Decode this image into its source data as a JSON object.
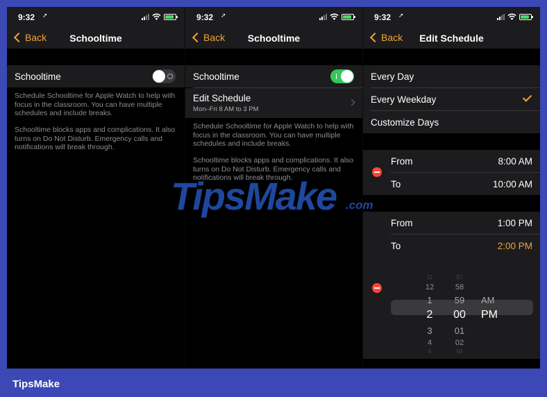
{
  "status": {
    "time": "9:32",
    "location_glyph": "➚"
  },
  "screens": [
    {
      "back_label": "Back",
      "title": "Schooltime",
      "toggle_label": "Schooltime",
      "toggle_on": false,
      "footnote1": "Schedule Schooltime for Apple Watch to help with focus in the classroom. You can have multiple schedules and include breaks.",
      "footnote2": "Schooltime blocks apps and complications. It also turns on Do Not Disturb. Emergency calls and notifications will break through."
    },
    {
      "back_label": "Back",
      "title": "Schooltime",
      "toggle_label": "Schooltime",
      "toggle_on": true,
      "edit_label": "Edit Schedule",
      "edit_sub": "Mon–Fri 8 AM to 3 PM",
      "footnote1": "Schedule Schooltime for Apple Watch to help with focus in the classroom. You can have multiple schedules and include breaks.",
      "footnote2": "Schooltime blocks apps and complications. It also turns on Do Not Disturb. Emergency calls and notifications will break through."
    },
    {
      "back_label": "Back",
      "title": "Edit Schedule",
      "options": [
        "Every Day",
        "Every Weekday",
        "Customize Days"
      ],
      "selected_option": "Every Weekday",
      "block1": {
        "from_label": "From",
        "from_value": "8:00 AM",
        "to_label": "To",
        "to_value": "10:00 AM"
      },
      "block2": {
        "from_label": "From",
        "from_value": "1:00 PM",
        "to_label": "To",
        "to_value": "2:00 PM"
      },
      "picker": {
        "hours": [
          "11",
          "12",
          "1",
          "2",
          "3",
          "4",
          "5"
        ],
        "minutes": [
          "57",
          "58",
          "59",
          "00",
          "01",
          "02",
          "03"
        ],
        "periods": [
          "AM",
          "PM"
        ]
      }
    }
  ],
  "watermark": {
    "text": "TipsMake",
    "suffix": ".com"
  },
  "brand": "TipsMake",
  "colors": {
    "accent": "#f3a33a",
    "toggle_on": "#34c759",
    "destructive": "#ff453a",
    "cell_bg": "#1c1c1e",
    "page_bg": "#3b48b5"
  }
}
